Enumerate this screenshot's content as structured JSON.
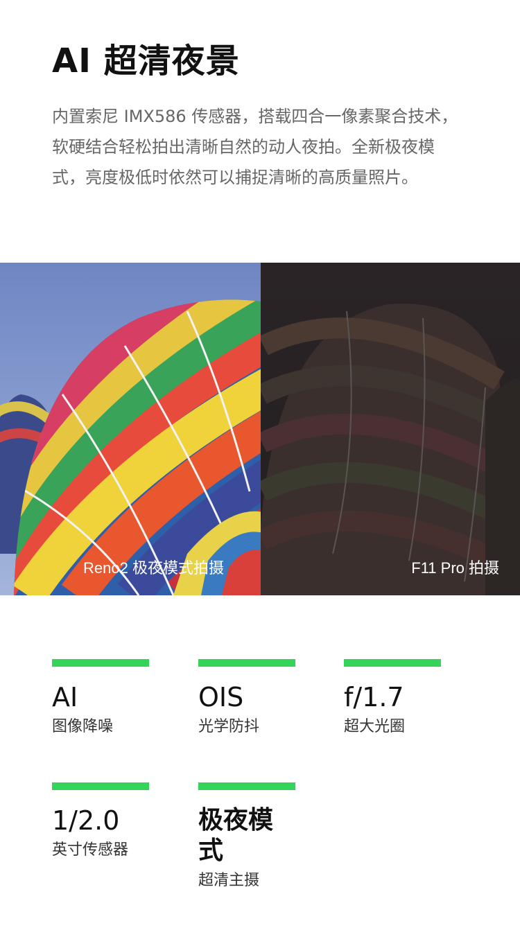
{
  "header": {
    "title": "AI 超清夜景",
    "description": "内置索尼 IMX586 传感器，搭载四合一像素聚合技术，软硬结合轻松拍出清晰自然的动人夜拍。全新极夜模式，亮度极低时依然可以捕捉清晰的高质量照片。"
  },
  "comparison": {
    "left_caption": "Reno2 极夜模式拍摄",
    "right_caption": "F11 Pro 拍摄"
  },
  "specs": [
    {
      "value": "AI",
      "label": "图像降噪"
    },
    {
      "value": "OIS",
      "label": "光学防抖"
    },
    {
      "value": "f/1.7",
      "label": "超大光圈"
    },
    {
      "value": "1/2.0",
      "label": "英寸传感器"
    },
    {
      "value": "极夜模式",
      "label": "超清主摄"
    }
  ],
  "colors": {
    "accent": "#34d35a",
    "title": "#111111",
    "body_text": "#666666"
  }
}
